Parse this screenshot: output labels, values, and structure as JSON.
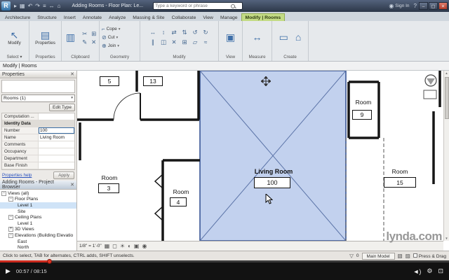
{
  "titlebar": {
    "title": "Adding Rooms - Floor Plan: Le...",
    "search_placeholder": "Type a keyword or phrase",
    "sign_in": "Sign In"
  },
  "ribbon": {
    "tabs": [
      "Architecture",
      "Structure",
      "Insert",
      "Annotate",
      "Analyze",
      "Massing & Site",
      "Collaborate",
      "View",
      "Manage",
      "Modify | Rooms"
    ],
    "modify_button": "Modify",
    "properties_button": "Properties",
    "geometry_items": [
      "Cope",
      "Cut",
      "Join"
    ],
    "panel_labels": [
      "Select ▾",
      "Properties",
      "Clipboard",
      "Geometry",
      "Modify",
      "View",
      "Measure",
      "Create"
    ]
  },
  "options_bar": {
    "label": "Modify | Rooms"
  },
  "properties": {
    "header": "Properties",
    "type_selector": "Rooms (1)",
    "edit_type": "Edit Type",
    "rows": [
      {
        "label": "Computation ...",
        "value": ""
      },
      {
        "label": "Number",
        "value": "100"
      },
      {
        "label": "Name",
        "value": "Living Room"
      },
      {
        "label": "Comments",
        "value": ""
      },
      {
        "label": "Occupancy",
        "value": ""
      },
      {
        "label": "Department",
        "value": ""
      },
      {
        "label": "Base Finish",
        "value": ""
      }
    ],
    "identity_header": "Identity Data",
    "help_link": "Properties help",
    "apply_button": "Apply"
  },
  "project_browser": {
    "header": "Adding Rooms - Project Browser",
    "items": [
      {
        "label": "Views (all)",
        "exp": "−"
      },
      {
        "label": "Floor Plans",
        "exp": "−"
      },
      {
        "label": "Level 1",
        "exp": ""
      },
      {
        "label": "Site",
        "exp": ""
      },
      {
        "label": "Ceiling Plans",
        "exp": "−"
      },
      {
        "label": "Level 1",
        "exp": ""
      },
      {
        "label": "3D Views",
        "exp": "+"
      },
      {
        "label": "Elevations (Building Elevatio",
        "exp": "−"
      },
      {
        "label": "East",
        "exp": ""
      },
      {
        "label": "North",
        "exp": ""
      }
    ]
  },
  "canvas": {
    "tag5": "5",
    "tag13": "13",
    "room9_label": "Room",
    "tag9": "9",
    "room3_label": "Room",
    "tag3": "3",
    "room4_label": "Room",
    "tag4": "4",
    "living_label": "Living Room",
    "tag100": "100",
    "room15_label": "Room",
    "tag15": "15",
    "selection_fill": "#b3c6ea",
    "selection_edge": "#2f4d8f"
  },
  "view_bar": {
    "scale": "1/8\" = 1'-0\""
  },
  "status_bar": {
    "hint": "Click to select, TAB for alternates, CTRL adds, SHIFT unselects.",
    "count": "0",
    "main_model": "Main Model",
    "press_drag": "Press & Drag"
  },
  "player": {
    "time": "00:57 / 08:15"
  },
  "watermark": "lynda.com",
  "icons": {
    "logo": "R",
    "open": "▸",
    "save": "▦",
    "undo": "↶",
    "redo": "↷",
    "print": "≡",
    "measure_qa": "↔",
    "home": "⌂",
    "signin": "◉",
    "help": "?",
    "min": "–",
    "max": "▢",
    "close": "✕",
    "modify_cursor": "↖",
    "properties": "▤",
    "paste": "▥",
    "cut": "✂",
    "copy": "⊞",
    "match": "✎",
    "cope": "⌐",
    "cut_geom": "⊘",
    "join": "⊕",
    "caret": "▾",
    "view": "▣",
    "measure": "↔",
    "create_a": "▭",
    "create_b": "⌂",
    "modify_tools": [
      "↔",
      "↕",
      "⇄",
      "⇅",
      "↺",
      "↻",
      "∥",
      "◫",
      "✕",
      "⊞",
      "▱",
      "≈"
    ],
    "detail": "▦",
    "style": "◻",
    "sun": "☀",
    "shadow": "◐",
    "crop": "▣",
    "reveal": "◉",
    "funnel": "▽",
    "worksets": "▧",
    "design_options": "▨",
    "up": "▲",
    "down": "▼",
    "play": "▶",
    "volume": "◄)",
    "gear": "⚙",
    "fullscreen": "⊡"
  }
}
